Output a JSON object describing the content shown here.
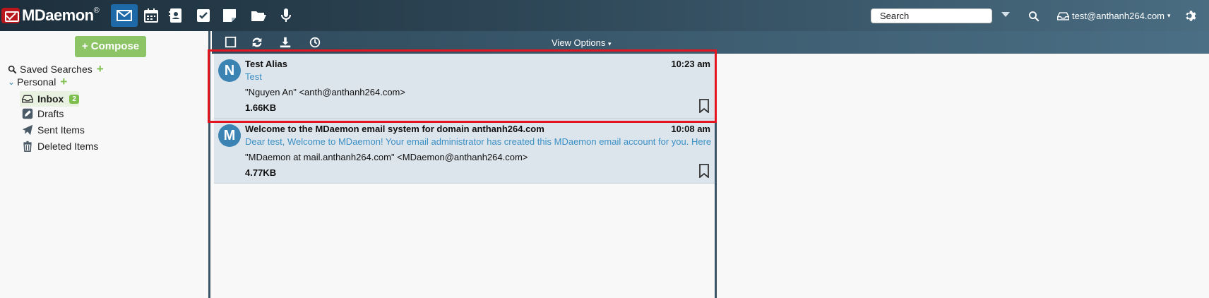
{
  "app": {
    "logo_text": "MDaemon",
    "logo_mark": "®"
  },
  "topbar": {
    "apps": [
      "mail-icon",
      "calendar-icon",
      "contacts-icon",
      "tasks-icon",
      "notes-icon",
      "documents-icon",
      "voice-icon"
    ],
    "search_placeholder": "Search",
    "account": "test@anthanh264.com"
  },
  "toolbar": {
    "view_options": "View Options"
  },
  "sidebar": {
    "compose_label": "Compose",
    "saved_searches": "Saved Searches",
    "personal": "Personal",
    "folders": [
      {
        "label": "Inbox",
        "badge": "2"
      },
      {
        "label": "Drafts"
      },
      {
        "label": "Sent Items"
      },
      {
        "label": "Deleted Items"
      }
    ]
  },
  "messages": [
    {
      "initial": "N",
      "from": "Test Alias",
      "time": "10:23 am",
      "subject": "Test",
      "address": "\"Nguyen An\" <anth@anthanh264.com>",
      "size": "1.66KB"
    },
    {
      "initial": "M",
      "from": "Welcome to the MDaemon email system for domain anthanh264.com",
      "time": "10:08 am",
      "subject": "Dear test, Welcome to MDaemon! Your email administrator has created this MDaemon email account for you. Here a",
      "address": "\"MDaemon at mail.anthanh264.com\" <MDaemon@anthanh264.com>",
      "size": "4.77KB"
    }
  ],
  "colors": {
    "accent": "#1e6aa8",
    "compose": "#8cc466",
    "highlight": "#e3151e",
    "subject_link": "#3a8fc5"
  }
}
